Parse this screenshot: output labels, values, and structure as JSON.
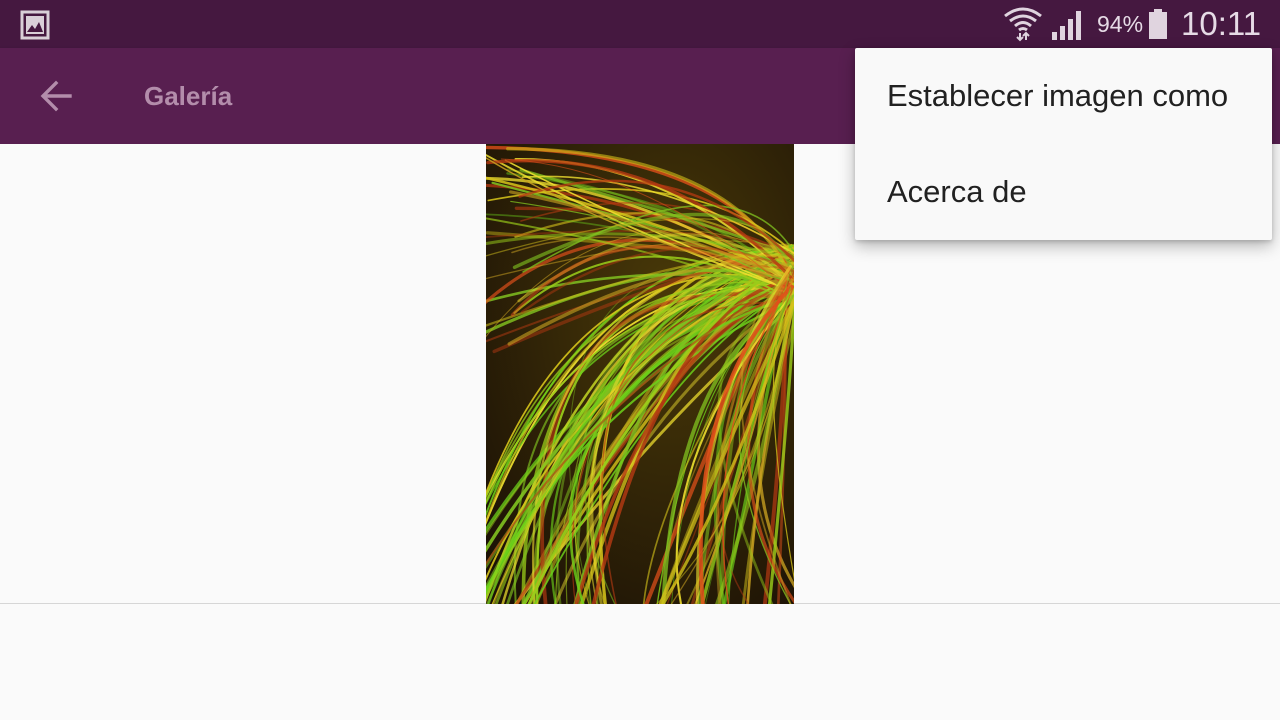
{
  "status_bar": {
    "left_icon": "gallery-notification-icon",
    "icons": [
      "wifi-icon",
      "signal-icon",
      "battery-icon"
    ],
    "battery_percent": "94%",
    "time": "10:11"
  },
  "app_bar": {
    "back_icon": "back-arrow-icon",
    "title": "Galería"
  },
  "image": {
    "description_icon": "swirl-wallpaper-image"
  },
  "overflow_menu": {
    "items": [
      {
        "label": "Establecer imagen como"
      },
      {
        "label": "Acerca de"
      }
    ]
  },
  "colors": {
    "status_bar": "#451840",
    "app_bar": "#581f50",
    "title_text": "#b38dab",
    "background": "#fafafa"
  }
}
